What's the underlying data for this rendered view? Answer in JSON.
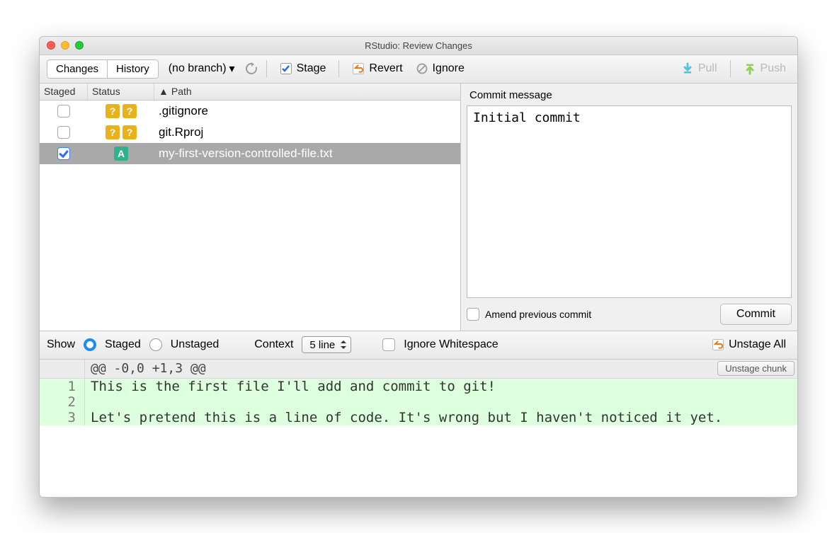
{
  "window": {
    "title": "RStudio: Review Changes"
  },
  "toolbar": {
    "tab_changes": "Changes",
    "tab_history": "History",
    "branch": "(no branch)",
    "stage": "Stage",
    "revert": "Revert",
    "ignore": "Ignore",
    "pull": "Pull",
    "push": "Push"
  },
  "file_table": {
    "col_staged": "Staged",
    "col_status": "Status",
    "col_path": "Path",
    "rows": [
      {
        "checked": false,
        "status": "??",
        "path": ".gitignore",
        "selected": false
      },
      {
        "checked": false,
        "status": "??",
        "path": "git.Rproj",
        "selected": false
      },
      {
        "checked": true,
        "status": "A",
        "path": "my-first-version-controlled-file.txt",
        "selected": true
      }
    ]
  },
  "commit": {
    "label": "Commit message",
    "message": "Initial commit",
    "amend": "Amend previous commit",
    "button": "Commit"
  },
  "diffbar": {
    "show": "Show",
    "staged": "Staged",
    "unstaged": "Unstaged",
    "context": "Context",
    "context_value": "5 line",
    "ignore_ws": "Ignore Whitespace",
    "unstage_all": "Unstage All"
  },
  "diff": {
    "hunk": "@@ -0,0 +1,3 @@",
    "unstage_chunk": "Unstage chunk",
    "lines": [
      {
        "n": "1",
        "text": "This is the first file I'll add and commit to git!"
      },
      {
        "n": "2",
        "text": ""
      },
      {
        "n": "3",
        "text": "Let's pretend this is a line of code. It's wrong but I haven't noticed it yet."
      }
    ]
  }
}
